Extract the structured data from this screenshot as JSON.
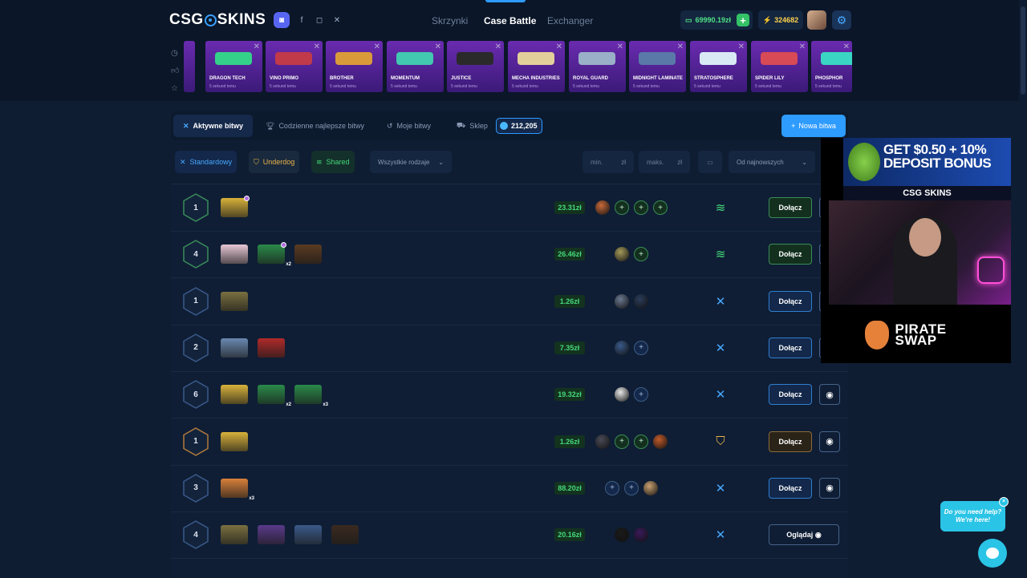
{
  "header": {
    "logo_left": "CSG",
    "logo_right": "SKINS",
    "nav": [
      "Skrzynki",
      "Case Battle",
      "Exchanger"
    ],
    "active_nav": "Case Battle",
    "balance": "69990.19zł",
    "points": "324682",
    "social": [
      "discord-icon",
      "facebook-icon",
      "instagram-icon",
      "x-icon"
    ]
  },
  "cases": [
    {
      "name": "DRAGON TECH",
      "sub": "5 sekund temu",
      "color": "#34d18a"
    },
    {
      "name": "VINO PRIMO",
      "sub": "5 sekund temu",
      "color": "#c13a4a"
    },
    {
      "name": "BROTHER",
      "sub": "5 sekund temu",
      "color": "#d99a3a"
    },
    {
      "name": "MOMENTUM",
      "sub": "5 sekund temu",
      "color": "#42c7b0"
    },
    {
      "name": "JUSTICE",
      "sub": "5 sekund temu",
      "color": "#2a2a2a"
    },
    {
      "name": "MECHA INDUSTRIES",
      "sub": "5 sekund temu",
      "color": "#e2d09a"
    },
    {
      "name": "ROYAL GUARD",
      "sub": "5 sekund temu",
      "color": "#9ab0c8"
    },
    {
      "name": "MIDNIGHT LAMINATE",
      "sub": "5 sekund temu",
      "color": "#5a78a8"
    },
    {
      "name": "STRATOSPHERE",
      "sub": "5 sekund temu",
      "color": "#d9eaf5"
    },
    {
      "name": "SPIDER LILY",
      "sub": "5 sekund temu",
      "color": "#d84a55"
    },
    {
      "name": "PHOSPHOR",
      "sub": "5 sekund temu",
      "color": "#3ad6c3"
    }
  ],
  "tabs": {
    "active": "Aktywne bitwy",
    "daily": "Codzienne najlepsze bitwy",
    "mine": "Moje bitwy",
    "shop": "Sklep",
    "coins": "212,205",
    "new_battle": "Nowa bitwa"
  },
  "filters": {
    "standard": "Standardowy",
    "underdog": "Underdog",
    "shared": "Shared",
    "all_types": "Wszystkie rodzaje",
    "min": "min.",
    "max": "maks.",
    "currency": "zł",
    "sort": "Od najnowszych"
  },
  "battles": [
    {
      "rounds": "1",
      "price": "23.31zł",
      "mode": "shared",
      "action": "Dołącz",
      "boxes": [
        {
          "c": "#d8b23a",
          "dot": true
        }
      ],
      "players": [
        "#c96a3a",
        "e",
        "e",
        "e"
      ]
    },
    {
      "rounds": "4",
      "price": "26.46zł",
      "mode": "shared",
      "action": "Dołącz",
      "boxes": [
        {
          "c": "#e7c7d6"
        },
        {
          "c": "#2a8a4a",
          "mult": "x2",
          "dot": true
        },
        {
          "c": "#5a3a20"
        }
      ],
      "players": [
        "#a59a5a",
        "e"
      ]
    },
    {
      "rounds": "1",
      "price": "1.26zł",
      "mode": "standard",
      "action": "Dołącz",
      "boxes": [
        {
          "c": "#7a7040"
        }
      ],
      "players": [
        "#6a7890",
        "#2a3c5a"
      ]
    },
    {
      "rounds": "2",
      "price": "7.35zł",
      "mode": "standard",
      "action": "Dołącz",
      "boxes": [
        {
          "c": "#6a88b0"
        },
        {
          "c": "#b02a2a"
        }
      ],
      "players": [
        "#3a5a8a",
        "e"
      ]
    },
    {
      "rounds": "6",
      "price": "19.32zł",
      "mode": "standard",
      "action": "Dołącz",
      "boxes": [
        {
          "c": "#d8b23a"
        },
        {
          "c": "#2a8a4a",
          "mult": "x2"
        },
        {
          "c": "#2a8a4a",
          "mult": "x3"
        }
      ],
      "players": [
        "#e8e8e8",
        "e"
      ]
    },
    {
      "rounds": "1",
      "price": "1.26zł",
      "mode": "underdog",
      "action": "Dołącz",
      "boxes": [
        {
          "c": "#d8b23a"
        }
      ],
      "players": [
        "#4a4a58",
        "e",
        "e",
        "#c05a2a"
      ]
    },
    {
      "rounds": "3",
      "price": "88.20zł",
      "mode": "standard",
      "action": "Dołącz",
      "boxes": [
        {
          "c": "#d8803a",
          "mult": "x3"
        }
      ],
      "players": [
        "e",
        "e",
        "#c8a070"
      ]
    },
    {
      "rounds": "4",
      "price": "20.16zł",
      "mode": "standard",
      "action": "Oglądaj",
      "boxes": [
        {
          "c": "#7a7040"
        },
        {
          "c": "#5a3a8a"
        },
        {
          "c": "#3a5a8a"
        },
        {
          "c": "#3a2a20"
        }
      ],
      "players": [
        "#1a1a1a",
        "#3a1a5a"
      ]
    }
  ],
  "overlay": {
    "ad_text": "GET $0.50 + 10% DEPOSIT BONUS",
    "ad_brand": "CSG SKINS",
    "sponsor": "PIRATE SWAP"
  },
  "help": {
    "text": "Do you need help? We're here!",
    "close": "×"
  }
}
